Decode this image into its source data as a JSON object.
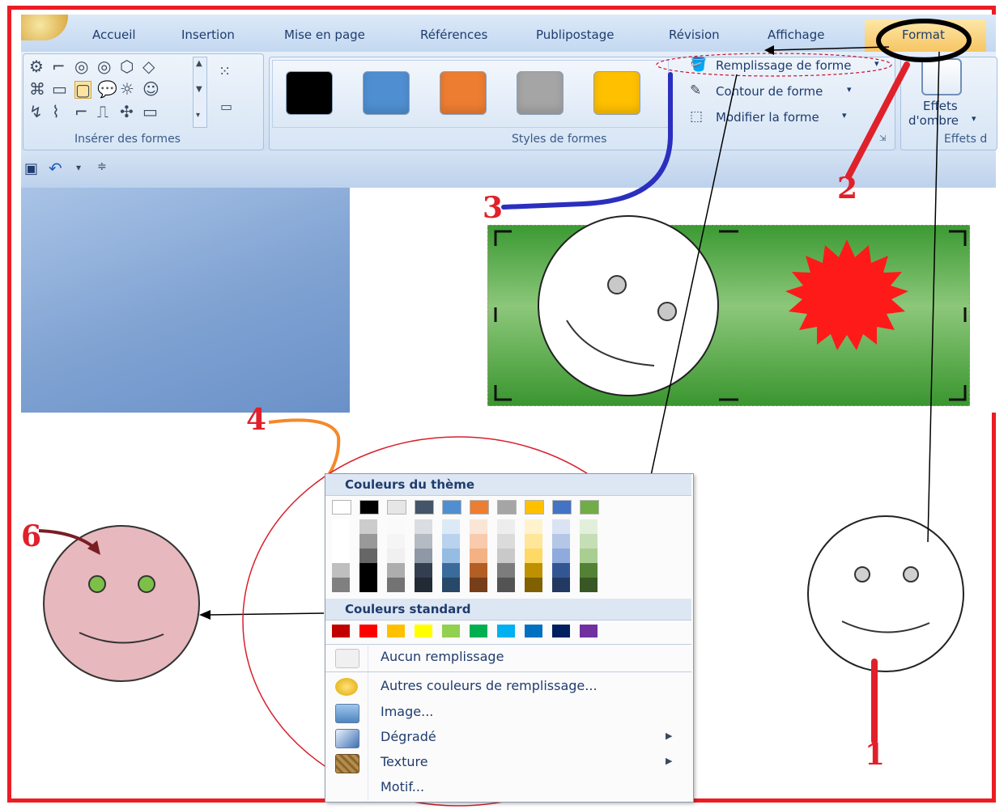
{
  "ribbon": {
    "tabs": [
      "Accueil",
      "Insertion",
      "Mise en page",
      "Références",
      "Publipostage",
      "Révision",
      "Affichage",
      "Format"
    ],
    "groups": {
      "insert_shapes": "Insérer des formes",
      "shape_styles": "Styles de formes",
      "shadow_effects": "Effets d"
    },
    "commands": {
      "fill": "Remplissage de forme",
      "outline": "Contour de forme",
      "change": "Modifier la forme",
      "shadow_line1": "Effets",
      "shadow_line2": "d'ombre"
    },
    "style_colors": [
      "#000000",
      "#4f8fd1",
      "#ed7d31",
      "#a5a5a5",
      "#ffc000"
    ]
  },
  "fill_menu": {
    "theme_header": "Couleurs du thème",
    "standard_header": "Couleurs standard",
    "theme_colors": [
      "#ffffff",
      "#000000",
      "#e6e6e6",
      "#44546a",
      "#4f8fd1",
      "#ed7d31",
      "#a5a5a5",
      "#ffc000",
      "#4472c4",
      "#70ad47"
    ],
    "standard_colors": [
      "#c00000",
      "#ff0000",
      "#ffc000",
      "#ffff00",
      "#92d050",
      "#00b050",
      "#00b0f0",
      "#0070c0",
      "#002060",
      "#7030a0"
    ],
    "items": {
      "no_fill": "Aucun remplissage",
      "more_colors": "Autres couleurs de remplissage...",
      "picture": "Image...",
      "gradient": "Dégradé",
      "texture": "Texture",
      "pattern": "Motif..."
    }
  },
  "annotations": {
    "m1": "1",
    "m2": "2",
    "m3": "3",
    "m4": "4",
    "m6": "6"
  }
}
